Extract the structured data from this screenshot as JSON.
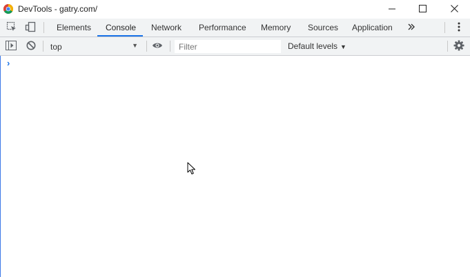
{
  "window": {
    "title": "DevTools - gatry.com/",
    "app_icon": "chrome-logo-icon",
    "controls": [
      "minimize-icon",
      "maximize-icon",
      "close-icon"
    ]
  },
  "tabs": {
    "items": [
      {
        "label": "Elements"
      },
      {
        "label": "Console",
        "active": true
      },
      {
        "label": "Network"
      },
      {
        "label": "Performance"
      },
      {
        "label": "Memory"
      },
      {
        "label": "Sources"
      },
      {
        "label": "Application"
      }
    ],
    "overflow_icon": "chevron-double-right-icon",
    "menu_icon": "kebab-menu-icon",
    "inspect_icon": "inspect-element-icon",
    "device_icon": "device-toolbar-icon"
  },
  "toolbar": {
    "sidebar_icon": "show-sidebar-icon",
    "clear_icon": "clear-console-icon",
    "context_value": "top",
    "eye_icon": "live-expression-eye-icon",
    "filter_placeholder": "Filter",
    "levels_label": "Default levels",
    "settings_icon": "gear-icon"
  },
  "console": {
    "prompt_symbol": "›"
  },
  "colors": {
    "accent": "#1a73e8",
    "toolbar_bg": "#f1f3f4",
    "border": "#cbcdd1"
  }
}
